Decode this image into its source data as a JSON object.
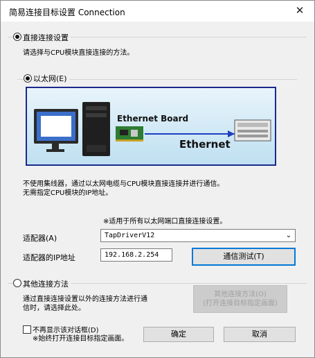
{
  "window": {
    "title": "简易连接目标设置 Connection",
    "close_glyph": "✕"
  },
  "direct": {
    "radio_label": "直接连接设置",
    "description": "请选择与CPU模块直接连接的方法。",
    "ethernet_radio_label": "以太网(E)",
    "diagram": {
      "board_label": "Ethernet Board",
      "network_label": "Ethernet"
    },
    "info_line1": "不使用集线器，通过以太网电缆与CPU模块直接连接并进行通信。",
    "info_line2": "无需指定CPU模块的IP地址。",
    "note": "※适用于所有以太网端口直接连接设置。",
    "adapter_label": "适配器(A)",
    "adapter_value": "TapDriverV12",
    "ip_label": "适配器的IP地址",
    "ip_value": "192.168.2.254",
    "test_button": "通信测试(T)"
  },
  "other": {
    "radio_label": "其他连接方法",
    "desc_line1": "通过直接连接设置以外的连接方法进行通",
    "desc_line2": "信时，请选择此处。",
    "button_line1": "其他连接方法(O)",
    "button_line2": "(打开连接目标指定画面)"
  },
  "footer": {
    "checkbox_label": "不再显示该对话框(D)",
    "checkbox_note": "※始终打开连接目标指定画面。",
    "ok_button": "确定",
    "cancel_button": "取消"
  }
}
